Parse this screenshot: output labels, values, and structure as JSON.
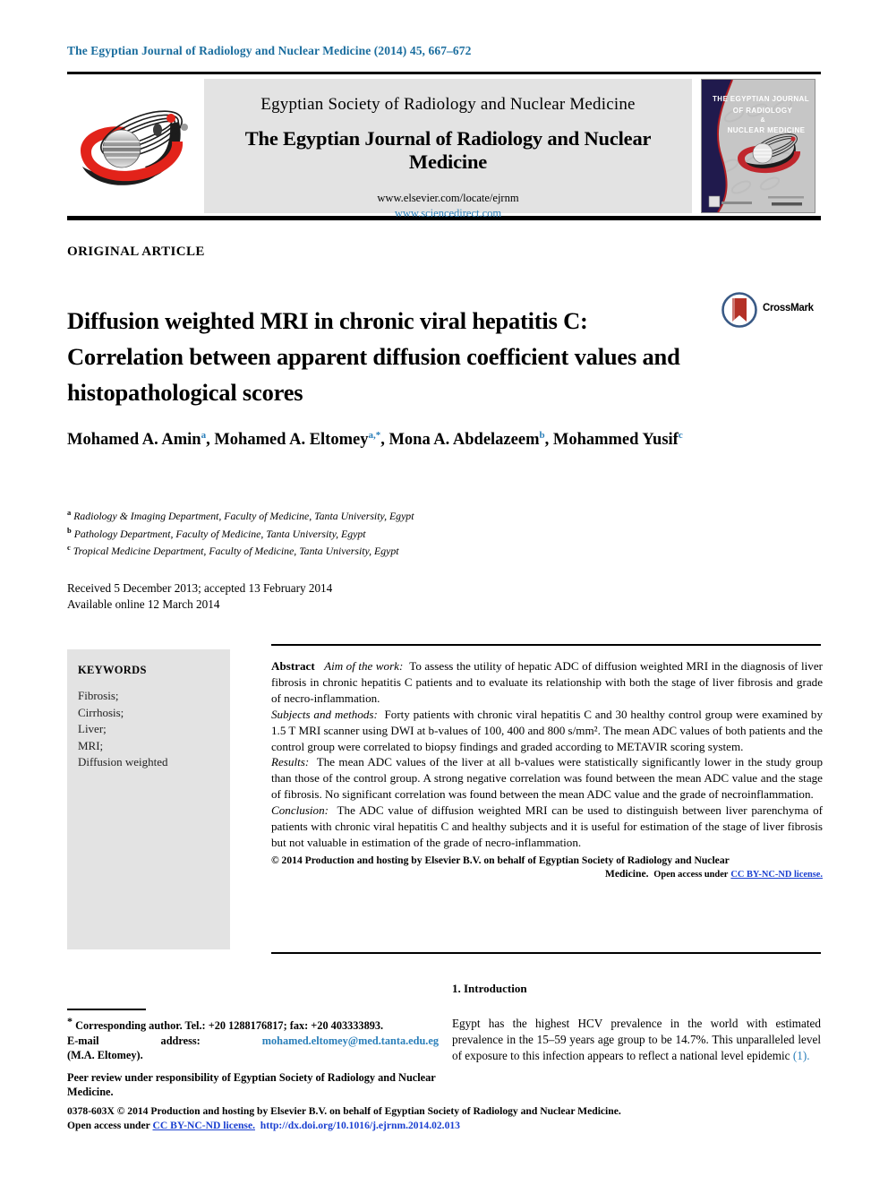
{
  "running_head": "The Egyptian Journal of Radiology and Nuclear Medicine (2014) 45, 667–672",
  "masthead": {
    "society": "Egyptian Society of Radiology and Nuclear Medicine",
    "journal": "The Egyptian Journal of Radiology and Nuclear Medicine",
    "url_elsevier": "www.elsevier.com/locate/ejrnm",
    "url_sciencedirect": "www.sciencedirect.com",
    "cover_line1": "THE EGYPTIAN JOURNAL",
    "cover_line2": "OF RADIOLOGY",
    "cover_line3": "&",
    "cover_line4": "NUCLEAR MEDICINE"
  },
  "article_type": "ORIGINAL ARTICLE",
  "title": "Diffusion weighted MRI in chronic viral hepatitis C: Correlation between apparent diffusion coefficient values and histopathological scores",
  "crossmark_label": "CrossMark",
  "authors": [
    {
      "name": "Mohamed A. Amin",
      "marks": "a",
      "sep": ", "
    },
    {
      "name": "Mohamed A. Eltomey",
      "marks": "a,*",
      "sep": ", "
    },
    {
      "name": "Mona A. Abdelazeem",
      "marks": "b",
      "sep": ", "
    },
    {
      "name": "Mohammed Yusif",
      "marks": "c",
      "sep": ""
    }
  ],
  "affiliations": [
    {
      "mark": "a",
      "text": "Radiology & Imaging Department, Faculty of Medicine, Tanta University, Egypt"
    },
    {
      "mark": "b",
      "text": "Pathology Department, Faculty of Medicine, Tanta University, Egypt"
    },
    {
      "mark": "c",
      "text": "Tropical Medicine Department, Faculty of Medicine, Tanta University, Egypt"
    }
  ],
  "history": {
    "line1": "Received 5 December 2013; accepted 13 February 2014",
    "line2": "Available online 12 March 2014"
  },
  "keywords": {
    "heading": "KEYWORDS",
    "items": "Fibrosis;\nCirrhosis;\nLiver;\nMRI;\nDiffusion weighted"
  },
  "abstract": {
    "label": "Abstract",
    "aim_label": "Aim of the work:",
    "aim_text": "To assess the utility of hepatic ADC of diffusion weighted MRI in the diagnosis of liver fibrosis in chronic hepatitis C patients and to evaluate its relationship with both the stage of liver fibrosis and grade of necro-inflammation.",
    "methods_label": "Subjects and methods:",
    "methods_text": "Forty patients with chronic viral hepatitis C and 30 healthy control group were examined by 1.5 T MRI scanner using DWI at b-values of 100, 400 and 800 s/mm². The mean ADC values of both patients and the control group were correlated to biopsy findings and graded according to METAVIR scoring system.",
    "results_label": "Results:",
    "results_text": "The mean ADC values of the liver at all b-values were statistically significantly lower in the study group than those of the control group. A strong negative correlation was found between the mean ADC value and the stage of fibrosis. No significant correlation was found between the mean ADC value and the grade of necroinflammation.",
    "conclusion_label": "Conclusion:",
    "conclusion_text": "The ADC value of diffusion weighted MRI can be used to distinguish between liver parenchyma of patients with chronic viral hepatitis C and healthy subjects and it is useful for estimation of the stage of liver fibrosis but not valuable in estimation of the grade of necro-inflammation.",
    "copyright": "© 2014 Production and hosting by Elsevier B.V. on behalf of Egyptian Society of Radiology and Nuclear",
    "copyright_tail": "Medicine.",
    "open_access": "Open access under",
    "license_link": "CC BY-NC-ND license."
  },
  "footnote": {
    "corresponding": "Corresponding author. Tel.: +20 1288176817; fax: +20 403333893.",
    "email_label": "E-mail",
    "email_address_label": "address:",
    "email": "mohamed.eltomey@med.tanta.edu.eg",
    "email_owner": "(M.A. Eltomey).",
    "peer_review": "Peer review under responsibility of Egyptian Society of Radiology and Nuclear Medicine."
  },
  "legal": {
    "line1": "0378-603X © 2014 Production and hosting by Elsevier B.V. on behalf of Egyptian Society of Radiology and Nuclear Medicine.",
    "open_access": "Open access under",
    "license_link": "CC BY-NC-ND license.",
    "doi": "http://dx.doi.org/10.1016/j.ejrnm.2014.02.013"
  },
  "introduction": {
    "heading": "1. Introduction",
    "paragraph": "Egypt has the highest HCV prevalence in the world with estimated prevalence in the 15–59 years age group to be 14.7%. This unparalleled level of exposure to this infection appears to reflect a national level epidemic",
    "citation": "(1)."
  },
  "colors": {
    "link_blue": "#2a7fba",
    "license_blue": "#1a3fd0",
    "panel_grey": "#e3e3e3",
    "logo_red": "#e2231a",
    "cover_navy": "#201a4d"
  }
}
